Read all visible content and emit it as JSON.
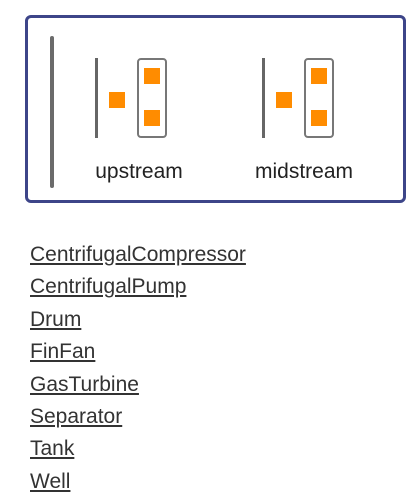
{
  "palette": {
    "items": [
      {
        "label": "upstream"
      },
      {
        "label": "midstream"
      }
    ],
    "accent_color": "#ff8c00",
    "border_color": "#3d4589"
  },
  "links": [
    "CentrifugalCompressor",
    "CentrifugalPump",
    "Drum",
    "FinFan",
    "GasTurbine",
    "Separator",
    "Tank",
    "Well"
  ]
}
